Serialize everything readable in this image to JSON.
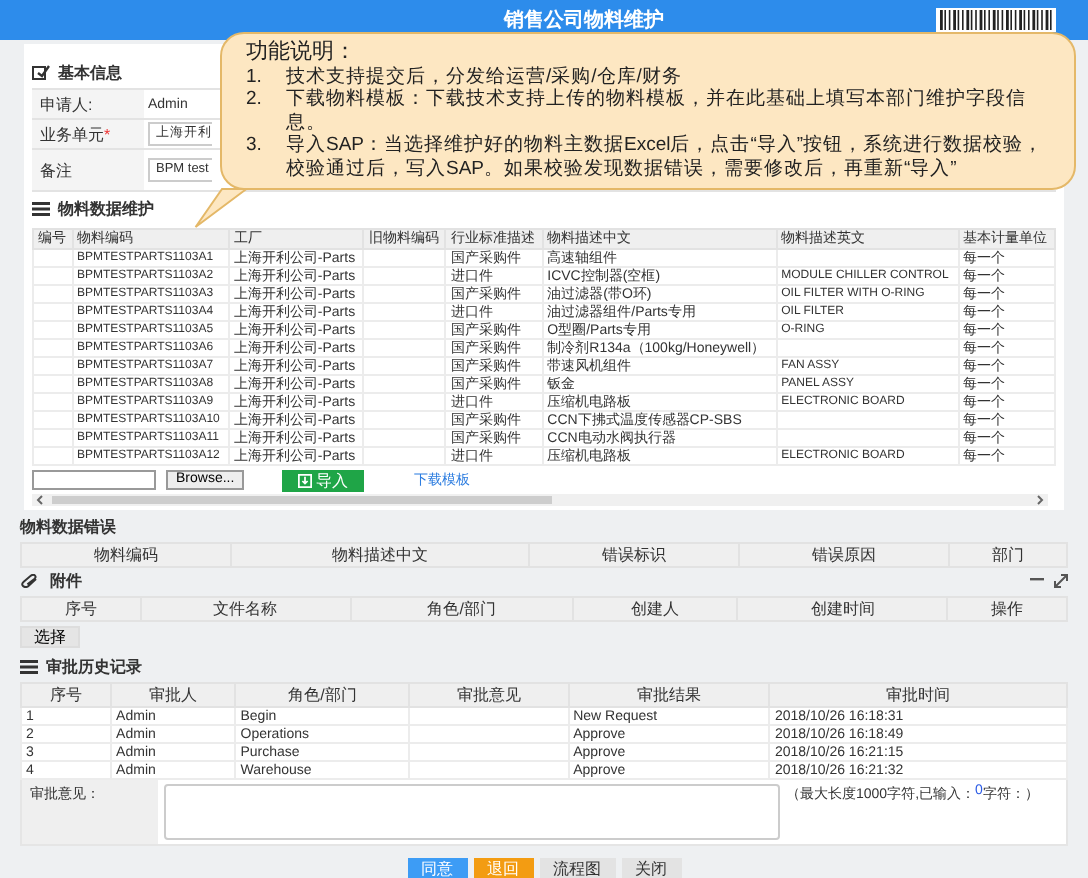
{
  "header": {
    "title": "销售公司物料维护"
  },
  "callout": {
    "title": "功能说明：",
    "items": [
      {
        "number": "1.",
        "text": "技术支持提交后，分发给运营/采购/仓库/财务"
      },
      {
        "number": "2.",
        "text": "下载物料模板：下载技术支持上传的物料模板，并在此基础上填写本部门维护字段信息。"
      },
      {
        "number": "3.",
        "text": "导入SAP：当选择维护好的物料主数据Excel后，点击“导入”按钮，系统进行数据校验，校验通过后，写入SAP。如果校验发现数据错误，需要修改后，再重新“导入”"
      }
    ]
  },
  "basic_info": {
    "title": "基本信息",
    "fields": [
      {
        "label": "申请人:",
        "kind": "text",
        "value": "Admin"
      },
      {
        "label": "业务单元",
        "mark": "*",
        "kind": "select",
        "value": "上海开利"
      },
      {
        "label": "备注",
        "kind": "input",
        "value": "BPM test"
      }
    ]
  },
  "materials": {
    "title": "物料数据维护",
    "columns": [
      "编号",
      "物料编码",
      "工厂",
      "旧物料编码",
      "行业标准描述",
      "物料描述中文",
      "物料描述英文",
      "基本计量单位"
    ],
    "rows": [
      [
        "",
        "BPMTESTPARTS1103A1",
        "上海开利公司-Parts",
        "",
        "国产采购件",
        "高速轴组件",
        "",
        "每一个"
      ],
      [
        "",
        "BPMTESTPARTS1103A2",
        "上海开利公司-Parts",
        "",
        "进口件",
        "ICVC控制器(空框)",
        "MODULE CHILLER CONTROL",
        "每一个"
      ],
      [
        "",
        "BPMTESTPARTS1103A3",
        "上海开利公司-Parts",
        "",
        "国产采购件",
        "油过滤器(带O环)",
        "OIL FILTER WITH O-RING",
        "每一个"
      ],
      [
        "",
        "BPMTESTPARTS1103A4",
        "上海开利公司-Parts",
        "",
        "进口件",
        "油过滤器组件/Parts专用",
        "OIL FILTER",
        "每一个"
      ],
      [
        "",
        "BPMTESTPARTS1103A5",
        "上海开利公司-Parts",
        "",
        "国产采购件",
        "O型圈/Parts专用",
        "O-RING",
        "每一个"
      ],
      [
        "",
        "BPMTESTPARTS1103A6",
        "上海开利公司-Parts",
        "",
        "国产采购件",
        "制冷剂R134a（100kg/Honeywell）",
        "",
        "每一个"
      ],
      [
        "",
        "BPMTESTPARTS1103A7",
        "上海开利公司-Parts",
        "",
        "国产采购件",
        "带速风机组件",
        "FAN ASSY",
        "每一个"
      ],
      [
        "",
        "BPMTESTPARTS1103A8",
        "上海开利公司-Parts",
        "",
        "国产采购件",
        "钣金",
        "PANEL ASSY",
        "每一个"
      ],
      [
        "",
        "BPMTESTPARTS1103A9",
        "上海开利公司-Parts",
        "",
        "进口件",
        "压缩机电路板",
        "ELECTRONIC BOARD",
        "每一个"
      ],
      [
        "",
        "BPMTESTPARTS1103A10",
        "上海开利公司-Parts",
        "",
        "国产采购件",
        "CCN下拂式温度传感器CP-SBS",
        "",
        "每一个"
      ],
      [
        "",
        "BPMTESTPARTS1103A11",
        "上海开利公司-Parts",
        "",
        "国产采购件",
        "CCN电动水阀执行器",
        "",
        "每一个"
      ],
      [
        "",
        "BPMTESTPARTS1103A12",
        "上海开利公司-Parts",
        "",
        "进口件",
        "压缩机电路板",
        "ELECTRONIC BOARD",
        "每一个"
      ]
    ],
    "browse_button": "Browse...",
    "import_button": "导入",
    "template_link": "下载模板"
  },
  "errors": {
    "title": "物料数据错误",
    "columns": [
      "物料编码",
      "物料描述中文",
      "错误标识",
      "错误原因",
      "部门"
    ]
  },
  "attachments": {
    "title": "附件",
    "columns": [
      "序号",
      "文件名称",
      "角色/部门",
      "创建人",
      "创建时间",
      "操作"
    ],
    "choose_button": "选择"
  },
  "history": {
    "title": "审批历史记录",
    "columns": [
      "序号",
      "审批人",
      "角色/部门",
      "审批意见",
      "审批结果",
      "审批时间"
    ],
    "rows": [
      [
        "1",
        "Admin",
        "Begin",
        "",
        "New Request",
        "2018/10/26 16:18:31"
      ],
      [
        "2",
        "Admin",
        "Operations",
        "",
        "Approve",
        "2018/10/26 16:18:49"
      ],
      [
        "3",
        "Admin",
        "Purchase",
        "",
        "Approve",
        "2018/10/26 16:21:15"
      ],
      [
        "4",
        "Admin",
        "Warehouse",
        "",
        "Approve",
        "2018/10/26 16:21:32"
      ]
    ],
    "comment_label": "审批意见：",
    "note_prefix": "（最大长度1000字符,已输入：",
    "note_count": "0",
    "note_suffix": " 字符：）"
  },
  "actions": [
    {
      "label": "同意",
      "kind": "primary"
    },
    {
      "label": "退回",
      "kind": "warning"
    },
    {
      "label": "流程图",
      "kind": "default"
    },
    {
      "label": "关闭",
      "kind": "default"
    }
  ]
}
